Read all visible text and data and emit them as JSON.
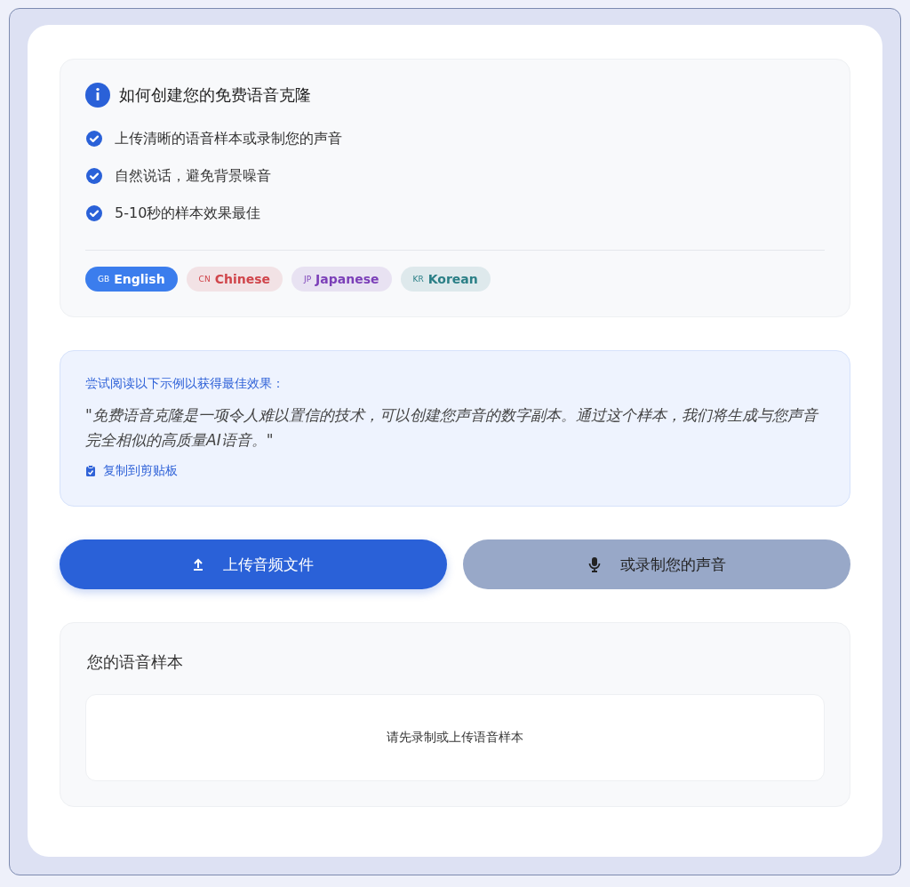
{
  "guide": {
    "title": "如何创建您的免费语音克隆",
    "tips": [
      "上传清晰的语音样本或录制您的声音",
      "自然说话，避免背景噪音",
      "5-10秒的样本效果最佳"
    ],
    "languages": [
      {
        "code": "GB",
        "label": "English",
        "selected": true,
        "color": "#3b7ded"
      },
      {
        "code": "CN",
        "label": "Chinese",
        "selected": false,
        "color": "#d0454b"
      },
      {
        "code": "JP",
        "label": "Japanese",
        "selected": false,
        "color": "#7b3fb8"
      },
      {
        "code": "KR",
        "label": "Korean",
        "selected": false,
        "color": "#2a7f86"
      }
    ]
  },
  "example": {
    "heading": "尝试阅读以下示例以获得最佳效果：",
    "quote": "\"免费语音克隆是一项令人难以置信的技术，可以创建您声音的数字副本。通过这个样本，我们将生成与您声音完全相似的高质量AI语音。\"",
    "copy_link": "复制到剪贴板"
  },
  "actions": [
    {
      "kind": "upload",
      "label": "上传音频文件",
      "disabled": false
    },
    {
      "kind": "record",
      "label": "或录制您的声音",
      "disabled": true
    }
  ],
  "sample": {
    "title": "您的语音样本",
    "empty_message": "请先录制或上传语音样本"
  }
}
